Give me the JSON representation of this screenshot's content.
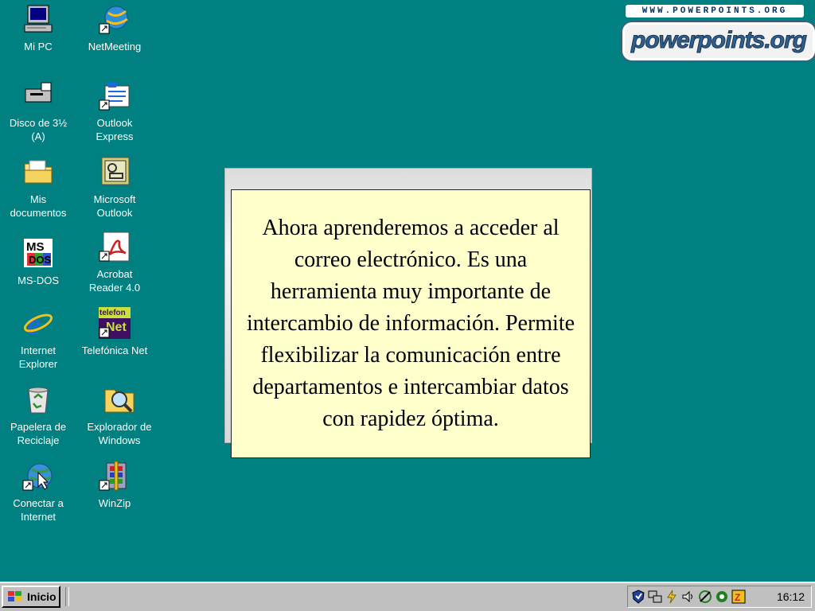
{
  "desktop": {
    "icons": [
      {
        "label": "Mi PC",
        "icon": "my-computer-icon"
      },
      {
        "label": "NetMeeting",
        "icon": "netmeeting-icon"
      },
      {
        "label": "Disco de 3½\n(A)",
        "icon": "floppy-drive-icon"
      },
      {
        "label": "Outlook\nExpress",
        "icon": "outlook-express-icon"
      },
      {
        "label": "Mis\ndocumentos",
        "icon": "folder-icon"
      },
      {
        "label": "Microsoft\nOutlook",
        "icon": "outlook-icon"
      },
      {
        "label": "MS-DOS",
        "icon": "ms-dos-icon"
      },
      {
        "label": "Acrobat\nReader 4.0",
        "icon": "acrobat-icon"
      },
      {
        "label": "Internet\nExplorer",
        "icon": "internet-explorer-icon"
      },
      {
        "label": "Telefónica Net",
        "icon": "telefonica-icon"
      },
      {
        "label": "Papelera de\nReciclaje",
        "icon": "recycle-bin-icon"
      },
      {
        "label": "Explorador de\nWindows",
        "icon": "explorer-icon"
      },
      {
        "label": "Conectar a\nInternet",
        "icon": "connect-internet-icon"
      },
      {
        "label": "WinZip",
        "icon": "winzip-icon"
      }
    ]
  },
  "logo": {
    "url_text": "WWW.POWERPOINTS.ORG",
    "brand_text": "powerpoints.org"
  },
  "message": {
    "text": "Ahora aprenderemos a acceder al correo electrónico. Es una herramienta muy importante de intercambio de información. Permite flexibilizar la comunicación entre departamentos e intercambiar datos con rapidez óptima."
  },
  "taskbar": {
    "start_label": "Inicio",
    "clock": "16:12",
    "tray_icons": [
      "shield-icon",
      "network-icon",
      "power-icon",
      "volume-icon",
      "link-icon",
      "security-icon",
      "language-icon"
    ]
  },
  "colors": {
    "desktop": "#008080",
    "taskbar": "#c0c0c0",
    "card": "#ffffcc"
  }
}
